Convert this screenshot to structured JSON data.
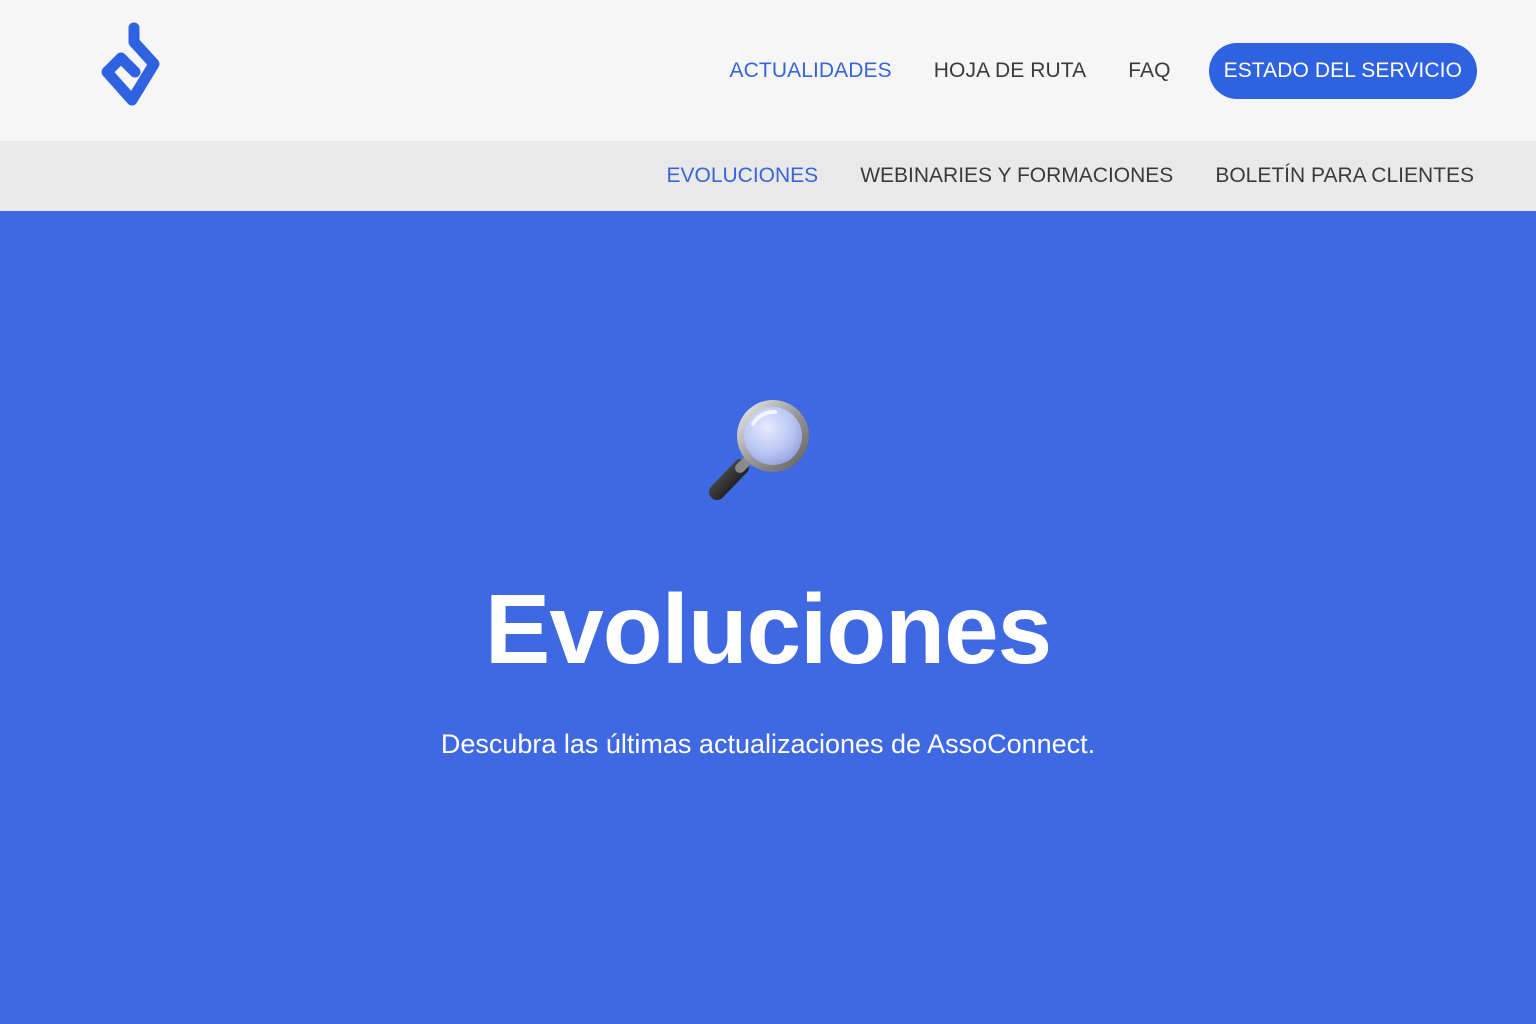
{
  "header": {
    "logo_icon": "assoconnect-logo-icon",
    "nav": [
      {
        "label": "ACTUALIDADES",
        "active": true
      },
      {
        "label": "HOJA DE RUTA",
        "active": false
      },
      {
        "label": "FAQ",
        "active": false
      }
    ],
    "cta_label": "ESTADO DEL SERVICIO"
  },
  "subnav": [
    {
      "label": "EVOLUCIONES",
      "active": true
    },
    {
      "label": "WEBINARIES Y FORMACIONES",
      "active": false
    },
    {
      "label": "BOLETÍN PARA CLIENTES",
      "active": false
    }
  ],
  "hero": {
    "icon": "magnifying-glass-icon",
    "title": "Evoluciones",
    "subtitle": "Descubra las últimas actualizaciones de AssoConnect."
  },
  "colors": {
    "brand_blue": "#3f69e3",
    "cta_blue": "#2f62e0",
    "active_link": "#3865d8"
  }
}
